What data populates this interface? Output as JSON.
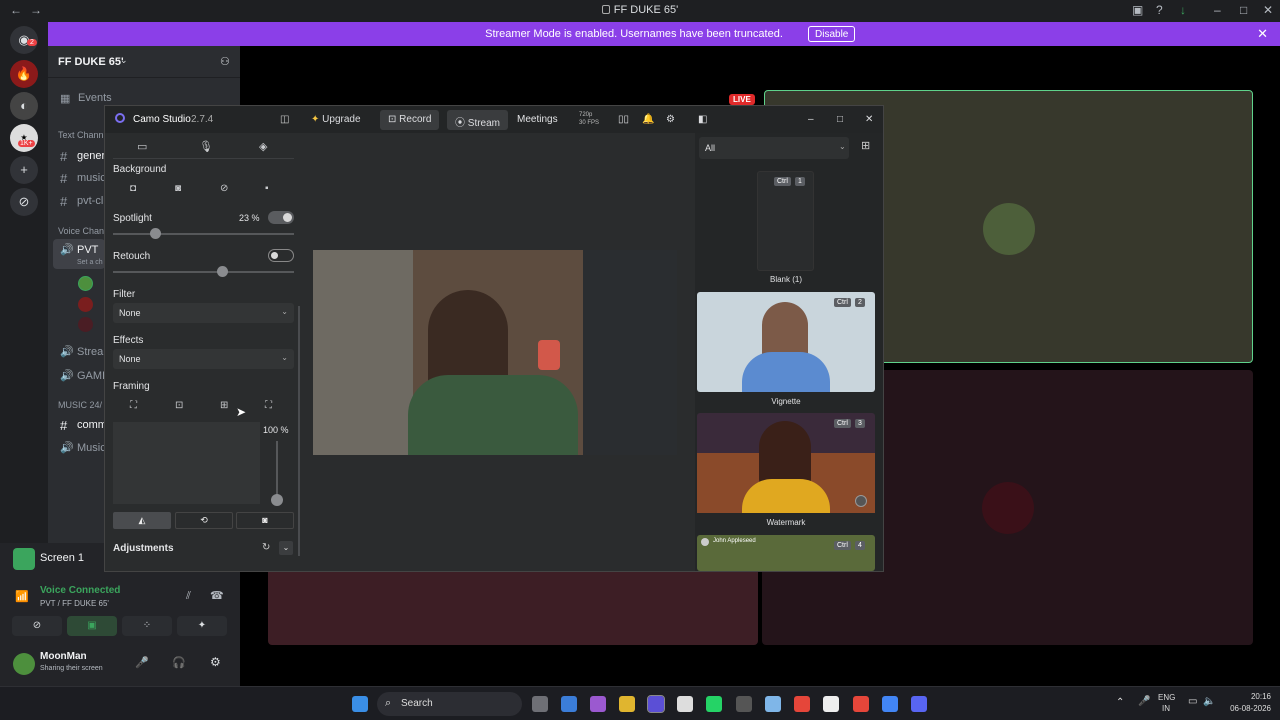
{
  "window": {
    "title": "FF DUKE 65'"
  },
  "banner": {
    "message": "Streamer Mode is enabled. Usernames have been truncated.",
    "disable_label": "Disable"
  },
  "server_badges": {
    "discord": "2",
    "server3": "1K+"
  },
  "guild": {
    "name": "FF DUKE 65'"
  },
  "channels": {
    "events": "Events",
    "text_header": "Text Chann",
    "text": [
      "genera",
      "music",
      "pvt-cl"
    ],
    "voice_header": "Voice Chann",
    "pvt": "PVT",
    "pvt_sub": "Set a ch",
    "others": [
      "Strea",
      "GAMI"
    ],
    "music_header": "MUSIC 24/",
    "music_ch": [
      "comm",
      "Music"
    ]
  },
  "voice": {
    "screen_label": "Screen 1",
    "status": "Voice Connected",
    "location": "PVT / FF DUKE 65'"
  },
  "user": {
    "name": "MoonMan",
    "status": "Sharing their screen"
  },
  "camo": {
    "title": "Camo Studio",
    "version": "2.7.4",
    "upgrade": "Upgrade",
    "record": "Record",
    "stream": "Stream",
    "meetings": "Meetings",
    "res": "720p",
    "fps": "30 FPS",
    "background_label": "Background",
    "spotlight_label": "Spotlight",
    "spotlight_value": "23 %",
    "spotlight_level": 0.23,
    "retouch_label": "Retouch",
    "retouch_level": 0.6,
    "filter_label": "Filter",
    "filter_value": "None",
    "effects_label": "Effects",
    "effects_value": "None",
    "framing_label": "Framing",
    "zoom_value": "100 %",
    "adjustments_label": "Adjustments",
    "filter_all": "All",
    "scenes": [
      {
        "label": "Blank (1)",
        "ctrl": "Ctrl",
        "num": "1"
      },
      {
        "label": "Vignette",
        "ctrl": "Ctrl",
        "num": "2"
      },
      {
        "label": "Watermark",
        "ctrl": "Ctrl",
        "num": "3"
      },
      {
        "label": "",
        "ctrl": "Ctrl",
        "num": "4",
        "caption": "John Appleseed"
      }
    ]
  },
  "live_badge": "LIVE",
  "taskbar": {
    "search": "Search",
    "lang1": "ENG",
    "lang2": "IN",
    "time": "20:16",
    "date": "06-08-2026"
  },
  "colors": {
    "banner": "#8b3fe8",
    "accent_green": "#5fd28b",
    "live_red": "#e02a2a"
  }
}
